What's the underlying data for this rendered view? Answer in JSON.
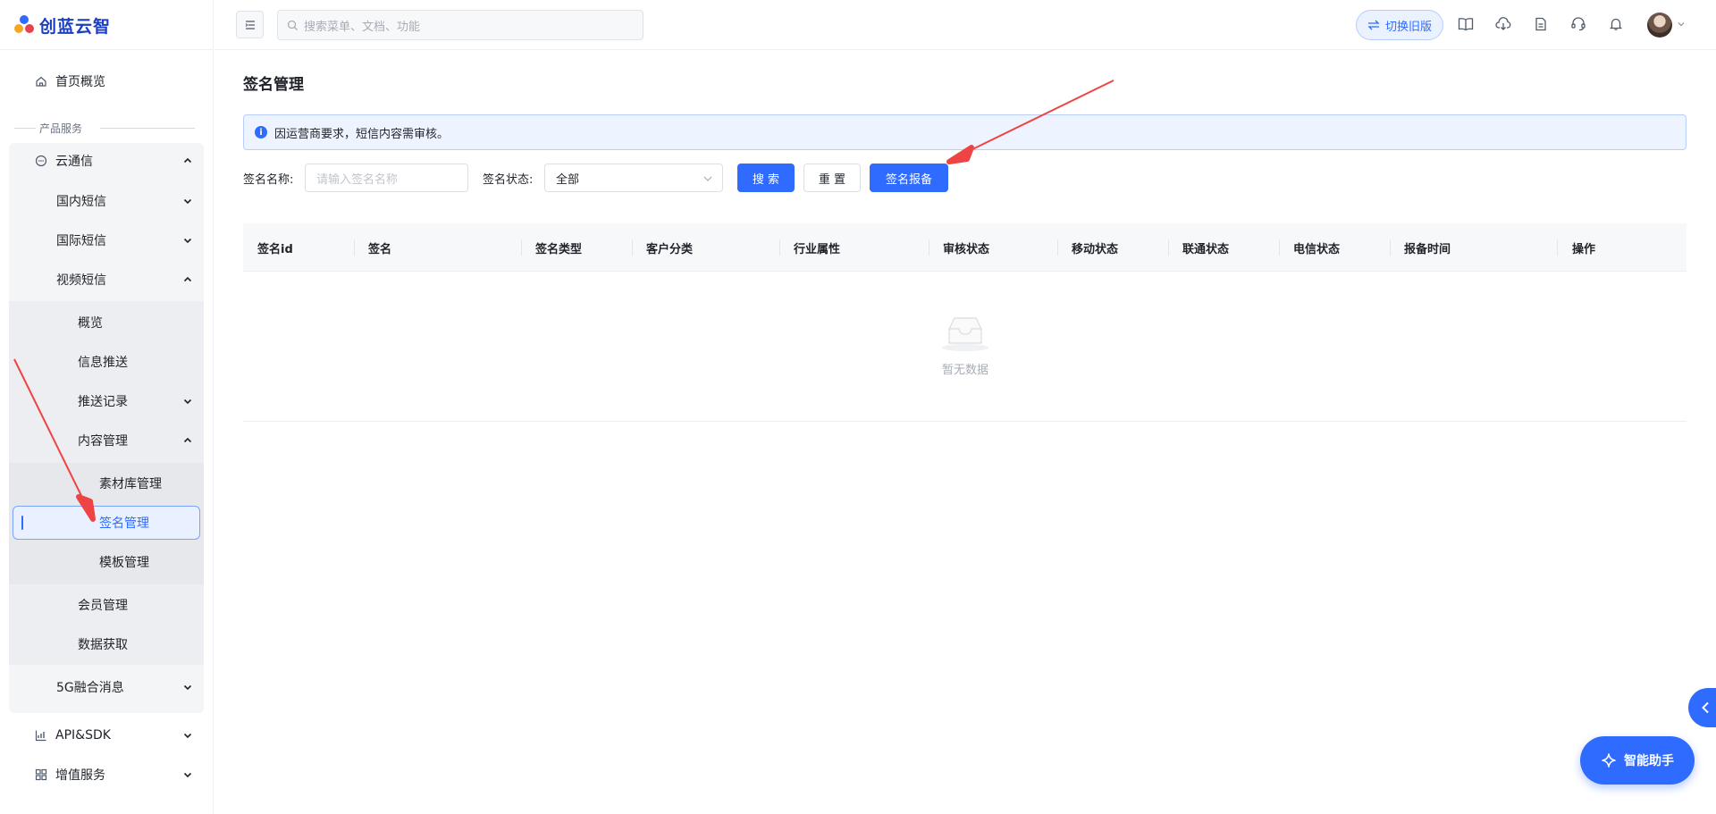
{
  "brand": {
    "name": "创蓝云智"
  },
  "sidebar": {
    "home": "首页概览",
    "section": "产品服务",
    "cloud_sms": "云通信",
    "domestic_sms": "国内短信",
    "intl_sms": "国际短信",
    "video_sms": "视频短信",
    "overview": "概览",
    "push": "信息推送",
    "push_records": "推送记录",
    "content_mgmt": "内容管理",
    "material_lib": "素材库管理",
    "signature_mgmt": "签名管理",
    "template_mgmt": "模板管理",
    "member_mgmt": "会员管理",
    "data_fetch": "数据获取",
    "g5": "5G融合消息",
    "api_sdk": "API&SDK",
    "value_added": "增值服务"
  },
  "topbar": {
    "search_placeholder": "搜索菜单、文档、功能",
    "switch_label": "切换旧版"
  },
  "page": {
    "title": "签名管理",
    "notice": "因运营商要求，短信内容需审核。"
  },
  "filters": {
    "name_label": "签名名称:",
    "name_placeholder": "请输入签名名称",
    "status_label": "签名状态:",
    "status_value": "全部",
    "search_btn": "搜 索",
    "reset_btn": "重 置",
    "report_btn": "签名报备"
  },
  "table": {
    "columns": [
      "签名id",
      "签名",
      "签名类型",
      "客户分类",
      "行业属性",
      "审核状态",
      "移动状态",
      "联通状态",
      "电信状态",
      "报备时间",
      "操作"
    ],
    "empty_text": "暂无数据"
  },
  "assistant": {
    "label": "智能助手"
  },
  "colors": {
    "primary": "#2f6bff",
    "annotation": "#ef4444"
  }
}
